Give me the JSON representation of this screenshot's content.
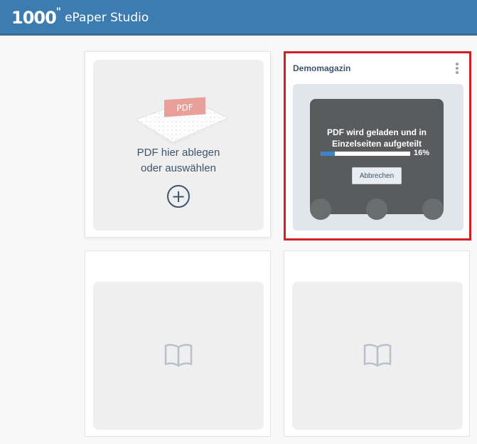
{
  "header": {
    "logo_mark": "1000",
    "logo_text": "ePaper Studio"
  },
  "upload": {
    "line1": "PDF hier ablegen",
    "line2": "oder auswählen",
    "pdf_badge": "PDF",
    "plus_symbol": "+"
  },
  "magazine": {
    "title": "Demomagazin",
    "status_line1": "PDF wird geladen und in",
    "status_line2": "Einzelseiten aufgeteilt",
    "progress_percent": 16,
    "progress_label": "16%",
    "cancel_label": "Abbrechen"
  },
  "colors": {
    "header_bg": "#3d7cb0",
    "highlight_border": "#d21f25",
    "text_primary": "#3d556c",
    "progress_fill": "#3d85c6"
  },
  "icons": {
    "upload": "plus-circle-icon",
    "placeholder": "open-book-icon",
    "menu": "kebab-menu-icon"
  }
}
